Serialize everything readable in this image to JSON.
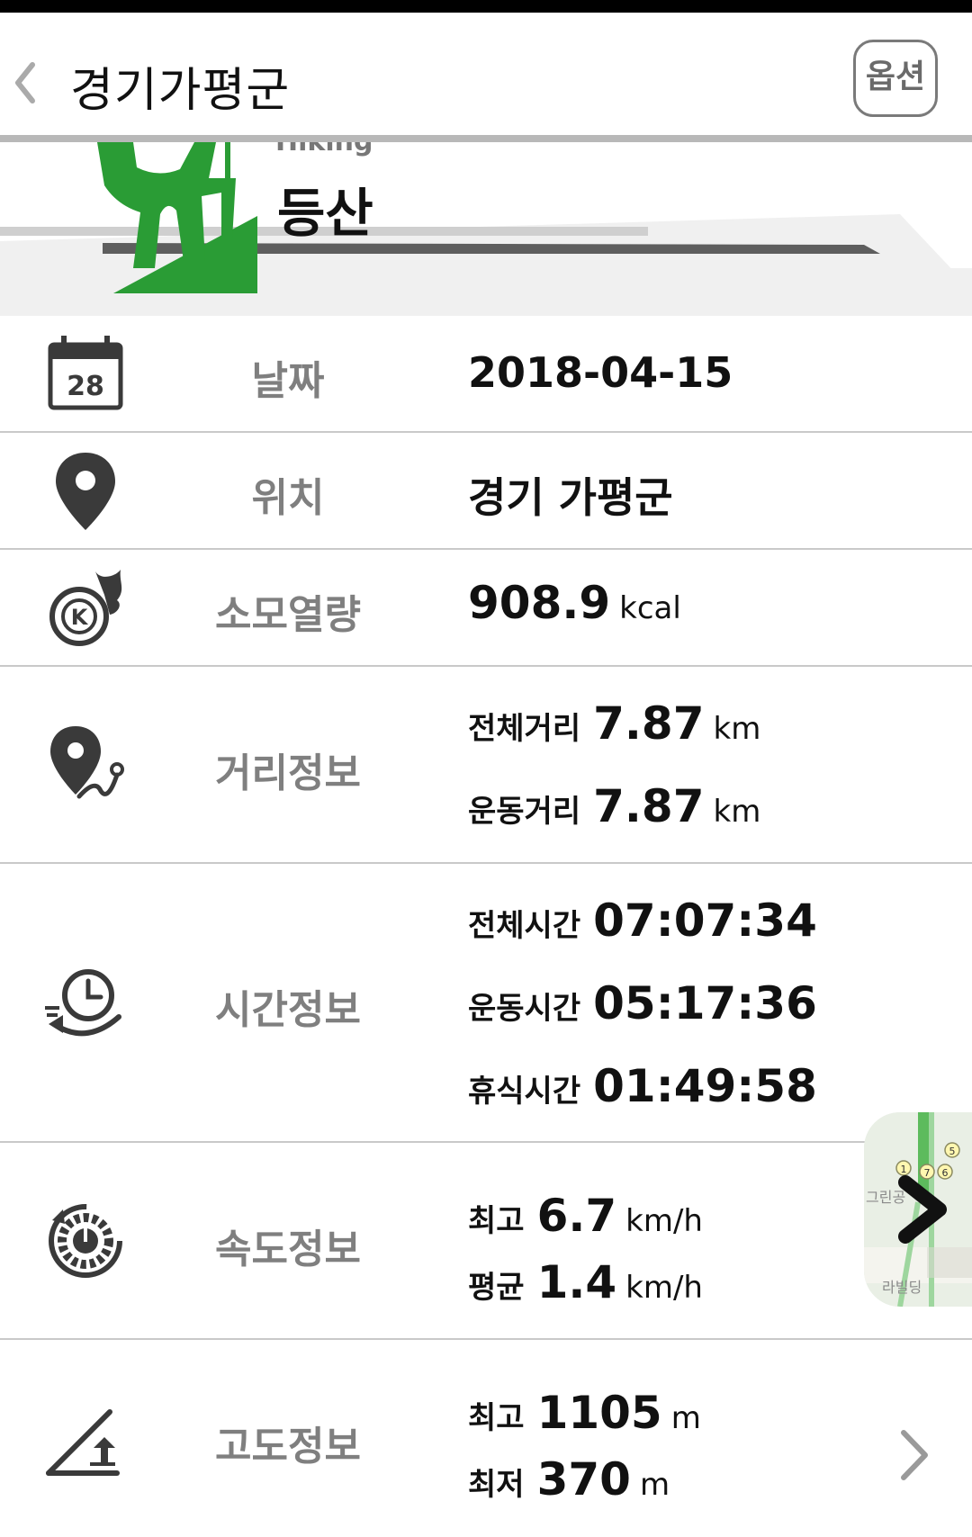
{
  "header": {
    "title": "경기가평군",
    "option_label": "옵션"
  },
  "activity": {
    "english": "Hiking",
    "korean": "등산",
    "accent_color": "#2a9c35"
  },
  "rows": {
    "date": {
      "label": "날짜",
      "value": "2018-04-15",
      "icon_text": "28"
    },
    "location": {
      "label": "위치",
      "value": "경기 가평군"
    },
    "calories": {
      "label": "소모열량",
      "value": "908.9",
      "unit": "kcal",
      "icon_text": "K"
    },
    "distance": {
      "label": "거리정보",
      "total_label": "전체거리",
      "total_value": "7.87",
      "total_unit": "km",
      "moving_label": "운동거리",
      "moving_value": "7.87",
      "moving_unit": "km"
    },
    "time": {
      "label": "시간정보",
      "total_label": "전체시간",
      "total_value": "07:07:34",
      "moving_label": "운동시간",
      "moving_value": "05:17:36",
      "rest_label": "휴식시간",
      "rest_value": "01:49:58"
    },
    "speed": {
      "label": "속도정보",
      "max_label": "최고",
      "max_value": "6.7",
      "max_unit": "km/h",
      "avg_label": "평균",
      "avg_value": "1.4",
      "avg_unit": "km/h"
    },
    "altitude": {
      "label": "고도정보",
      "max_label": "최고",
      "max_value": "1105",
      "max_unit": "m",
      "min_label": "최저",
      "min_value": "370",
      "min_unit": "m"
    }
  },
  "map_thumb": {
    "text_1": "그린공",
    "text_2": "라빌딩",
    "markers": [
      "1",
      "7",
      "6",
      "5"
    ]
  }
}
